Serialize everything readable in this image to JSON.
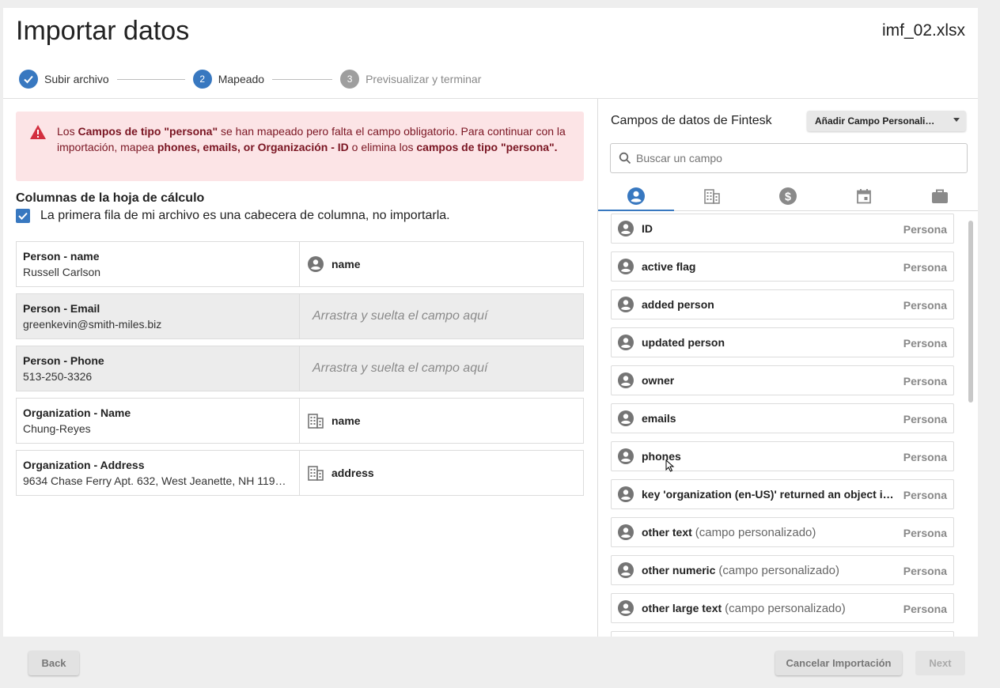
{
  "header": {
    "title": "Importar datos",
    "filename": "imf_02.xlsx"
  },
  "stepper": {
    "steps": [
      {
        "number": "",
        "label": "Subir archivo",
        "state": "done"
      },
      {
        "number": "2",
        "label": "Mapeado",
        "state": "active"
      },
      {
        "number": "3",
        "label": "Previsualizar y terminar",
        "state": "pending"
      }
    ]
  },
  "alert": {
    "t1": "Los ",
    "b1": "Campos de tipo \"persona\"",
    "t2": " se han mapeado pero falta el campo obligatorio. Para continuar con la importación, mapea ",
    "b2": "phones, emails, or Organización - ID",
    "t3": " o elimina los ",
    "b3": "campos de tipo \"persona\"."
  },
  "columns": {
    "heading": "Columnas de la hoja de cálculo",
    "header_checkbox_label": "La primera fila de mi archivo es una cabecera de columna, no importarla.",
    "drop_placeholder": "Arrastra y suelta el campo aquí",
    "rows": [
      {
        "source": "Person - name",
        "sample": "Russell Carlson",
        "target": "name",
        "target_icon": "person-icon"
      },
      {
        "source": "Person - Email",
        "sample": "greenkevin@smith-miles.biz",
        "target": "",
        "target_icon": ""
      },
      {
        "source": "Person - Phone",
        "sample": "513-250-3326",
        "target": "",
        "target_icon": ""
      },
      {
        "source": "Organization - Name",
        "sample": "Chung-Reyes",
        "target": "name",
        "target_icon": "building-icon"
      },
      {
        "source": "Organization - Address",
        "sample": "9634 Chase Ferry Apt. 632, West Jeanette, NH 119…",
        "target": "address",
        "target_icon": "building-icon"
      }
    ]
  },
  "fields_panel": {
    "title": "Campos de datos de Fintesk",
    "add_custom_label": "Añadir Campo Personali…",
    "search_placeholder": "Buscar un campo",
    "tabs": [
      "person-icon",
      "building-icon",
      "dollar-icon",
      "calendar-icon",
      "briefcase-icon"
    ],
    "fields": [
      {
        "name": "ID",
        "suffix": "",
        "type": "Persona"
      },
      {
        "name": "active flag",
        "suffix": "",
        "type": "Persona"
      },
      {
        "name": "added person",
        "suffix": "",
        "type": "Persona"
      },
      {
        "name": "updated person",
        "suffix": "",
        "type": "Persona"
      },
      {
        "name": "owner",
        "suffix": "",
        "type": "Persona"
      },
      {
        "name": "emails",
        "suffix": "",
        "type": "Persona"
      },
      {
        "name": "phones",
        "suffix": "",
        "type": "Persona"
      },
      {
        "name": "key 'organization (en-US)' returned an object i…",
        "suffix": "",
        "type": "Persona"
      },
      {
        "name": "other text",
        "suffix": "(campo personalizado)",
        "type": "Persona"
      },
      {
        "name": "other numeric",
        "suffix": "(campo personalizado)",
        "type": "Persona"
      },
      {
        "name": "other large text",
        "suffix": "(campo personalizado)",
        "type": "Persona"
      }
    ]
  },
  "footer": {
    "back_label": "Back",
    "cancel_label": "Cancelar Importación",
    "next_label": "Next"
  },
  "colors": {
    "accent": "#3878c0",
    "alert_bg": "#fce4e6",
    "alert_text": "#7a1522",
    "alert_icon": "#d32f3f"
  }
}
